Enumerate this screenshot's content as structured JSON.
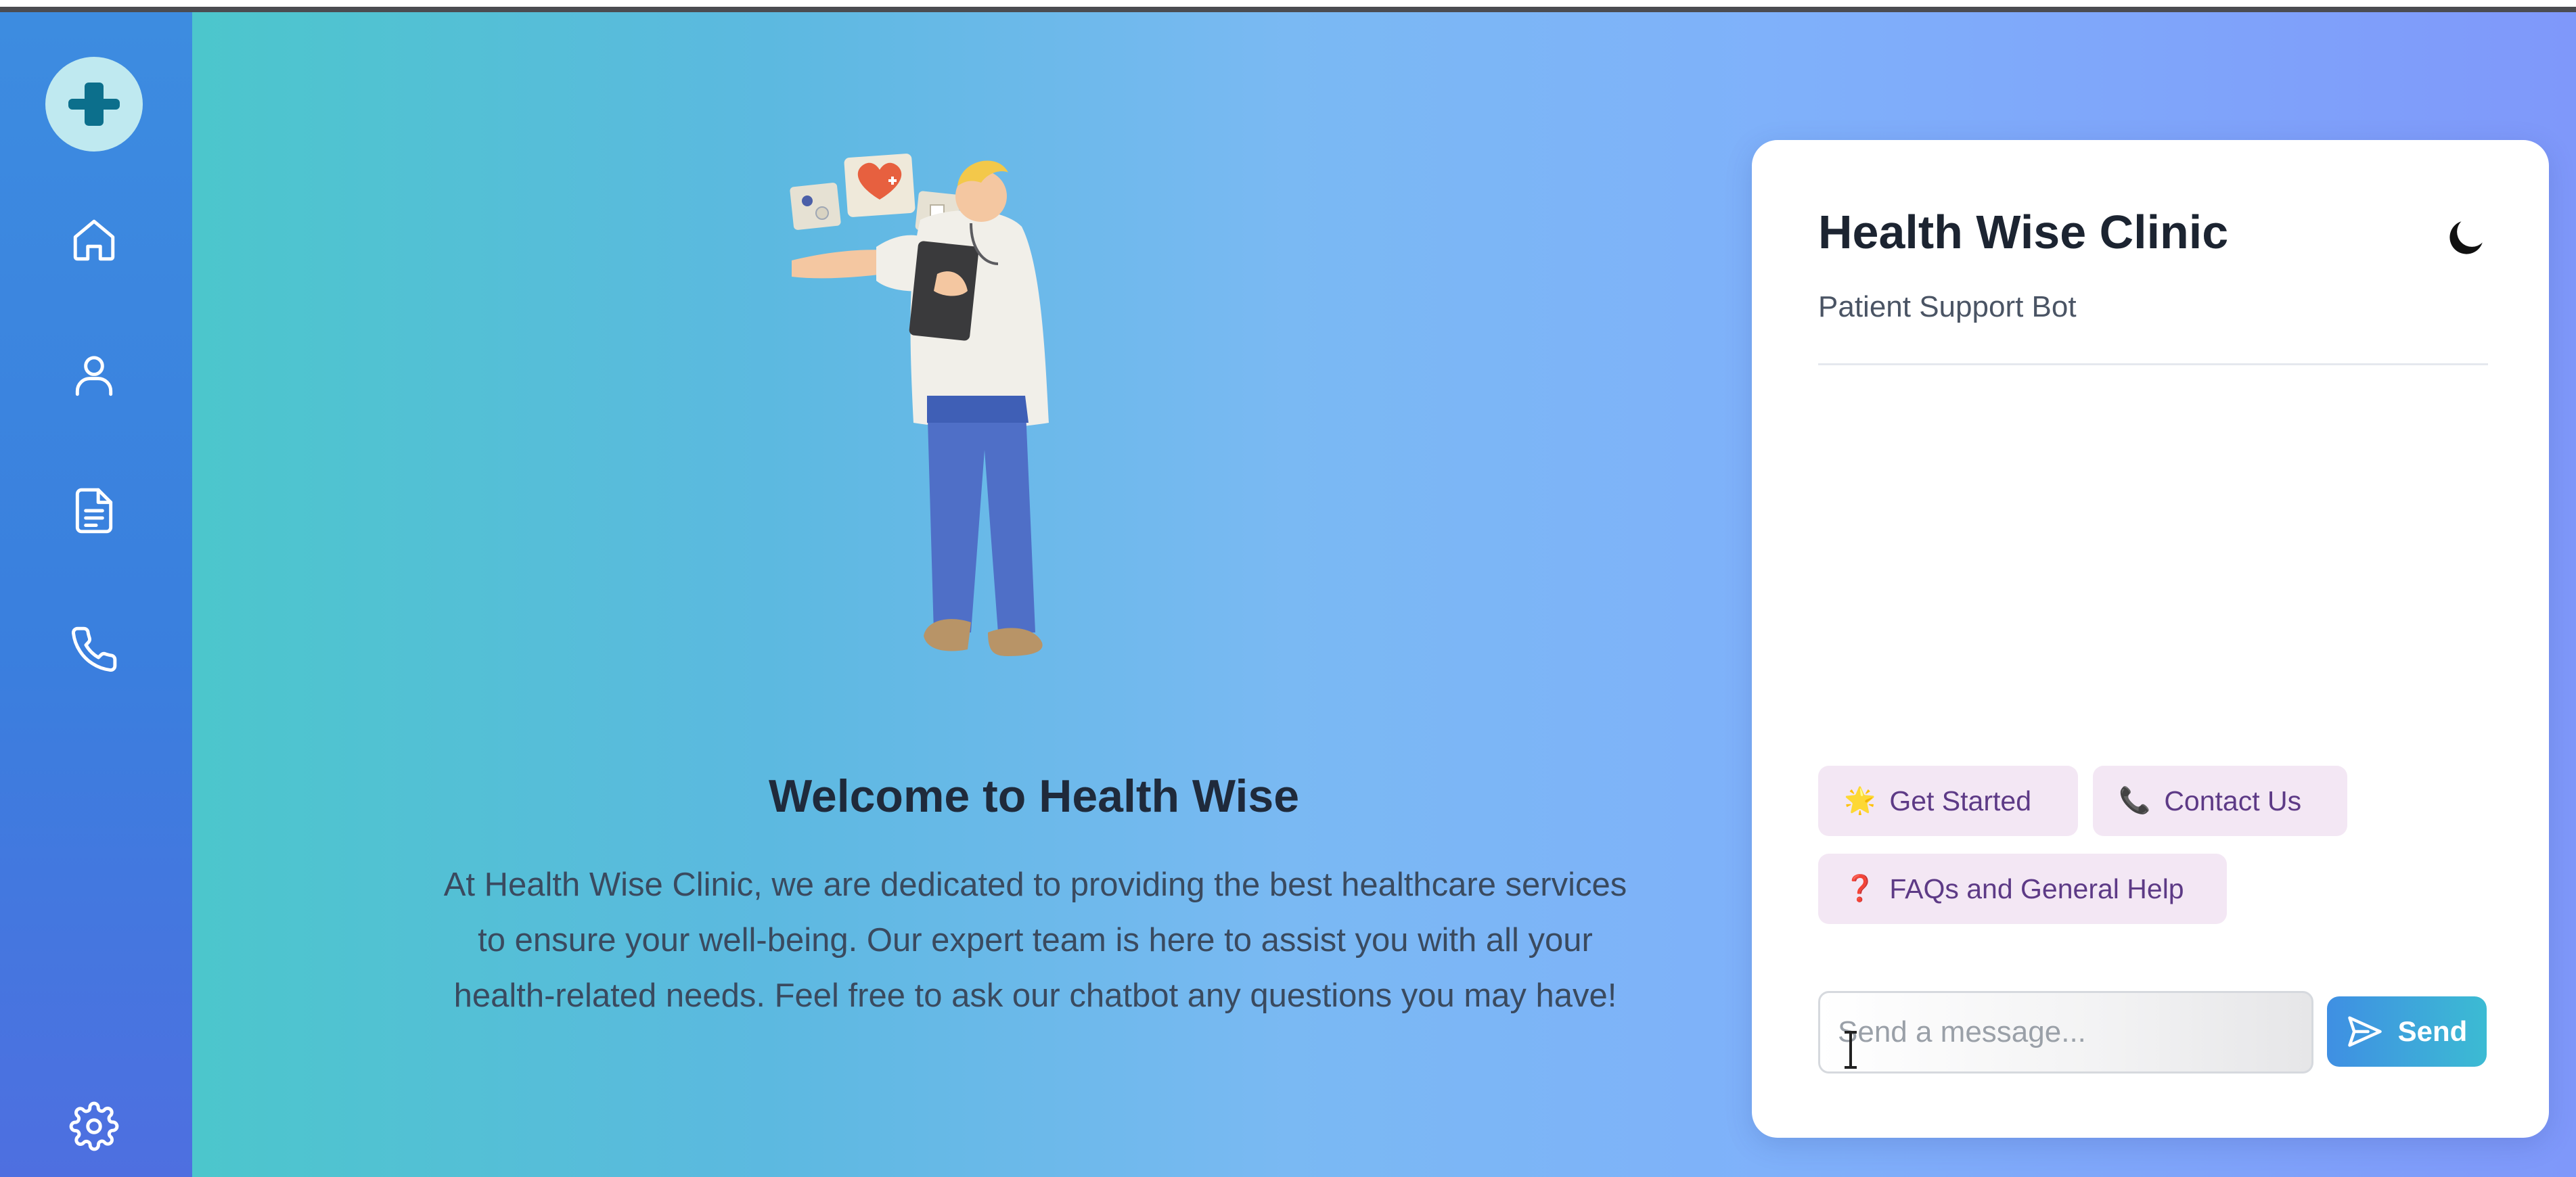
{
  "sidebar": {
    "logo_icon": "plus-cross-icon",
    "nav_icons": [
      "home-icon",
      "user-icon",
      "document-icon",
      "phone-icon"
    ],
    "bottom_icon": "gear-icon",
    "colors": {
      "sidebar_top": "#3d8ce0",
      "sidebar_bottom": "#4e6fe0",
      "logo_bg": "#bfe9f0",
      "logo_fg": "#0c6f8c"
    }
  },
  "main": {
    "welcome_title": "Welcome to Health Wise",
    "welcome_text": "At Health Wise Clinic, we are dedicated to providing the best healthcare services to ensure your well-being. Our expert team is here to assist you with all your health-related needs. Feel free to ask our chatbot any questions you may have!",
    "illustration": "doctor-holding-tablet-illustration"
  },
  "chat": {
    "title": "Health Wise Clinic",
    "subtitle": "Patient Support Bot",
    "theme_icon": "moon-icon",
    "quick_replies": [
      {
        "emoji": "🌟",
        "label": "Get Started"
      },
      {
        "emoji": "📞",
        "label": "Contact Us"
      },
      {
        "emoji": "❓",
        "label": "FAQs and General Help"
      }
    ],
    "input_placeholder": "Send a message...",
    "send_label": "Send",
    "send_icon": "paper-plane-icon"
  },
  "colors": {
    "gradient_start": "#4cc6cc",
    "gradient_end": "#7f98fa",
    "chip_bg": "#f3e7f4",
    "chip_text": "#5d3a86",
    "send_start": "#3f8fe3",
    "send_end": "#3cbbd3"
  }
}
